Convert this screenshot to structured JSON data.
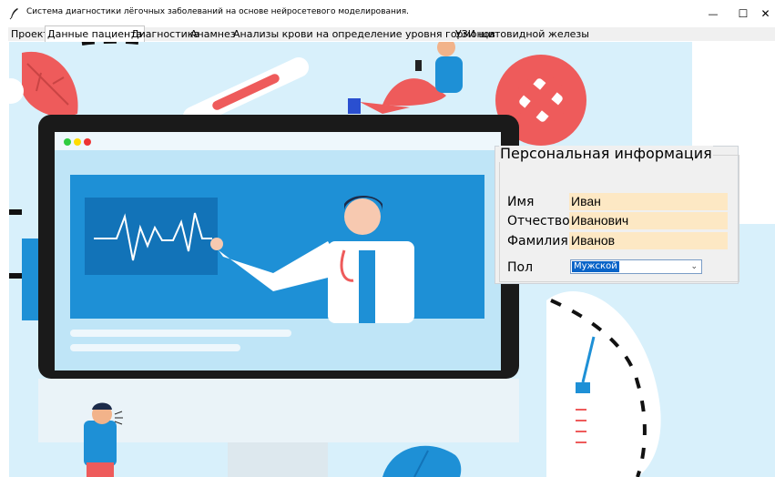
{
  "window": {
    "title": "Система диагностики лёгочных заболеваний на основе нейросетевого моделирования.",
    "controls": {
      "minimize": "—",
      "maximize": "☐",
      "close": "✕"
    }
  },
  "tabs": [
    {
      "label": "Проект",
      "active": false
    },
    {
      "label": "Данные пациента",
      "active": true
    },
    {
      "label": "Диагностика",
      "active": false
    },
    {
      "label": "Анамнез",
      "active": false
    },
    {
      "label": "Анализы крови на определение уровня гормонов",
      "active": false
    },
    {
      "label": "УЗИ щитовидной железы",
      "active": false
    }
  ],
  "personal_info": {
    "title": "Персональная информация",
    "fields": [
      {
        "label": "Имя",
        "value": "Иван"
      },
      {
        "label": "Отчество",
        "value": "Иванович"
      },
      {
        "label": "Фамилия",
        "value": "Иванов"
      }
    ],
    "sex": {
      "label": "Пол",
      "value": "Мужской"
    }
  },
  "colors": {
    "background": "#d8f0fb",
    "monitor_screen": "#bfe5f7",
    "monitor_blue": "#1e90d6",
    "monitor_bezel": "#1a1a1a",
    "accent_red": "#ee5b5b",
    "field_bg": "#fde8c4",
    "select_highlight": "#0a64c8"
  }
}
